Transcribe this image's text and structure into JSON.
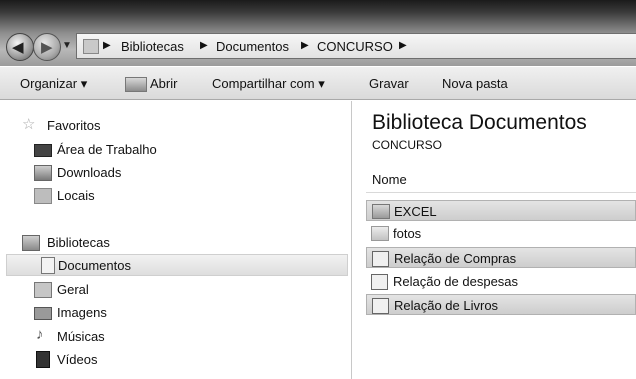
{
  "address": {
    "crumbs": [
      "Bibliotecas",
      "Documentos",
      "CONCURSO"
    ]
  },
  "toolbar": {
    "organize_label": "Organizar ▾",
    "open_label": "Abrir",
    "share_label": "Compartilhar com ▾",
    "burn_label": "Gravar",
    "new_folder_label": "Nova pasta"
  },
  "nav": {
    "favorites_label": "Favoritos",
    "favorites": [
      {
        "label": "Área de Trabalho",
        "icon": "desktop-icon"
      },
      {
        "label": "Downloads",
        "icon": "downloads-icon"
      },
      {
        "label": "Locais",
        "icon": "recent-places-icon"
      }
    ],
    "libraries_label": "Bibliotecas",
    "libraries": [
      {
        "label": "Documentos",
        "icon": "documents-icon",
        "selected": true
      },
      {
        "label": "Geral",
        "icon": "general-icon"
      },
      {
        "label": "Imagens",
        "icon": "pictures-icon"
      },
      {
        "label": "Músicas",
        "icon": "music-icon"
      },
      {
        "label": "Vídeos",
        "icon": "videos-icon"
      }
    ]
  },
  "content": {
    "title": "Biblioteca Documentos",
    "subtitle": "CONCURSO",
    "column_name": "Nome",
    "files": [
      {
        "name": "EXCEL",
        "type": "folder",
        "highlighted": true
      },
      {
        "name": "fotos",
        "type": "folder",
        "highlighted": false
      },
      {
        "name": "Relação de Compras",
        "type": "document",
        "highlighted": true
      },
      {
        "name": "Relação de despesas",
        "type": "document",
        "highlighted": false
      },
      {
        "name": "Relação de Livros",
        "type": "document",
        "highlighted": true
      }
    ]
  }
}
